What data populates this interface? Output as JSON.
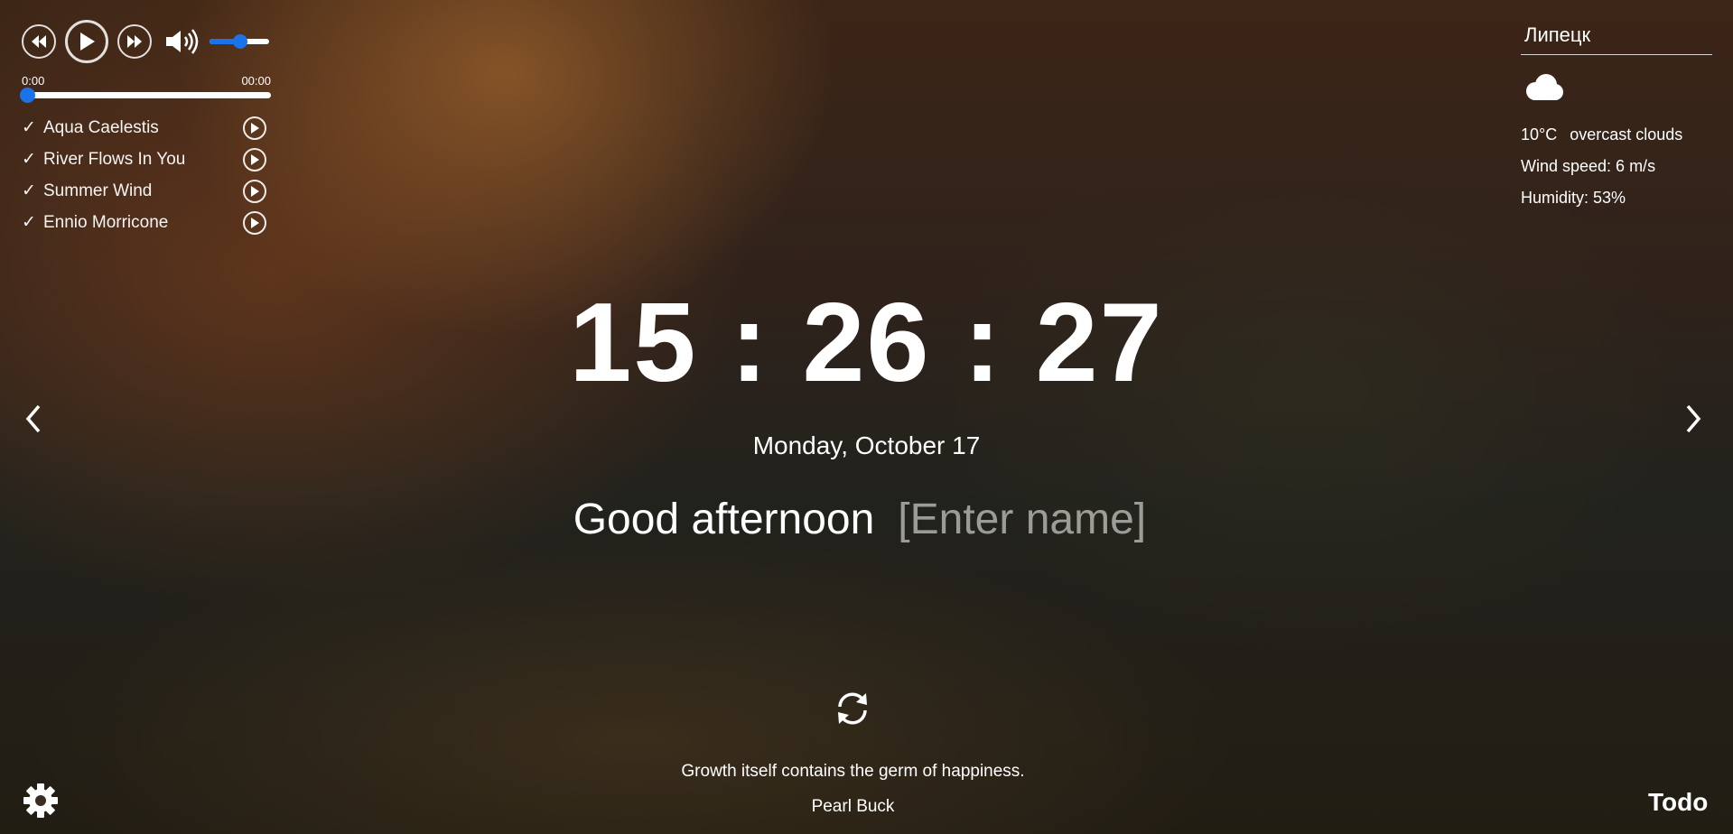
{
  "player": {
    "current_time": "0:00",
    "duration": "00:00",
    "volume_level": 0.5,
    "progress": 0,
    "icons": [
      "rewind-icon",
      "play-icon",
      "fast-forward-icon",
      "volume-icon"
    ],
    "playlist": [
      {
        "check": "✓",
        "title": "Aqua Caelestis"
      },
      {
        "check": "✓",
        "title": "River Flows In You"
      },
      {
        "check": "✓",
        "title": "Summer Wind"
      },
      {
        "check": "✓",
        "title": "Ennio Morricone"
      }
    ]
  },
  "weather": {
    "city": "Липецк",
    "icon": "cloud-icon",
    "temperature": "10°C",
    "description": "overcast clouds",
    "wind": "Wind speed: 6 m/s",
    "humidity": "Humidity: 53%"
  },
  "clock": {
    "time": "15:26:27",
    "date": "Monday, October 17"
  },
  "greeting": {
    "text": "Good afternoon",
    "name_placeholder": "[Enter name]",
    "name_value": ""
  },
  "quote": {
    "text": "Growth itself contains the germ of happiness.",
    "author": "Pearl Buck"
  },
  "footer": {
    "todo_label": "Todo"
  },
  "colors": {
    "accent": "#1a73e8",
    "text": "#ffffff"
  }
}
